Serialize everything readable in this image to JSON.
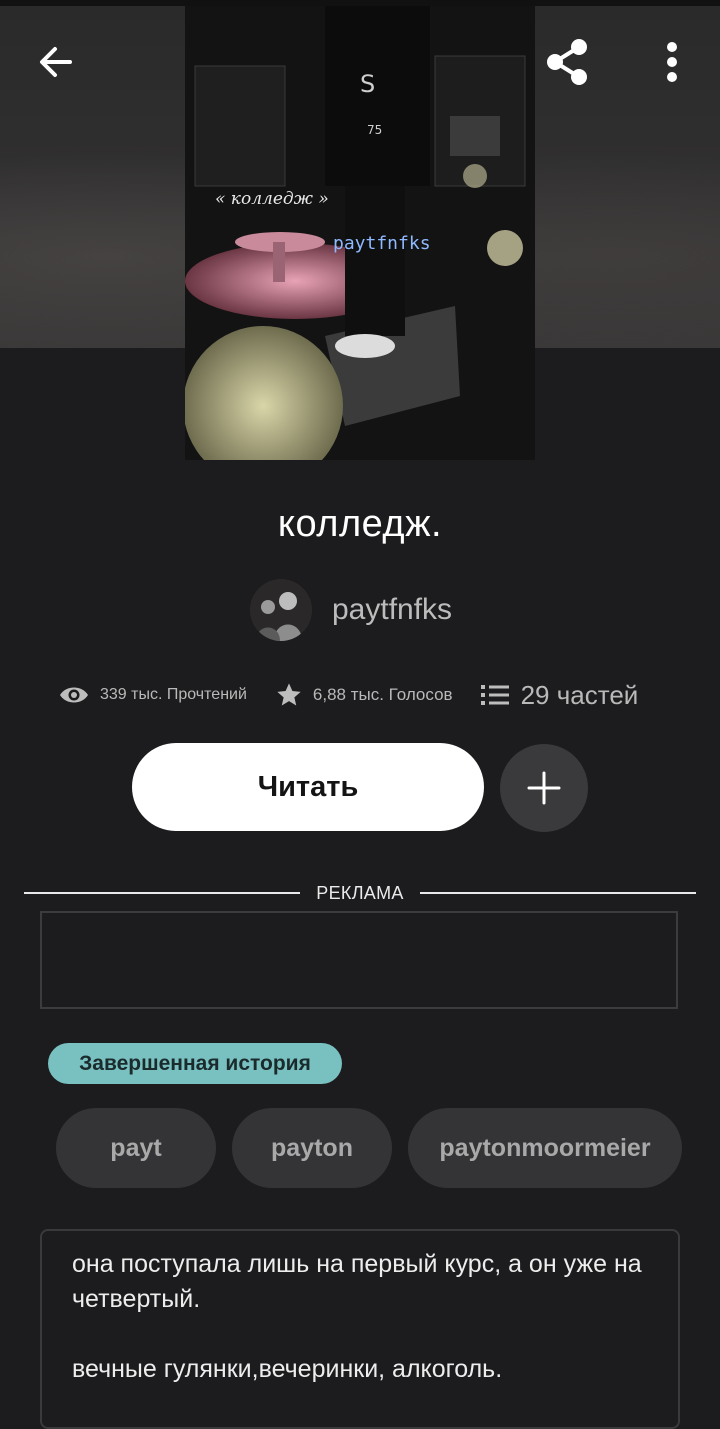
{
  "header": {
    "back_icon": "arrow-left-icon",
    "share_icon": "share-icon",
    "menu_icon": "more-vertical-icon"
  },
  "cover": {
    "title_text": "« колледж »",
    "author_text": "paytfnfks"
  },
  "story": {
    "title": "колледж.",
    "author": "paytfnfks"
  },
  "stats": {
    "reads": "339 тыс. Прочтений",
    "votes": "6,88 тыс. Голосов",
    "parts": "29 частей"
  },
  "actions": {
    "read_label": "Читать",
    "add_icon": "plus-icon"
  },
  "ad": {
    "label": "РЕКЛАМА"
  },
  "status_badge": "Завершенная история",
  "tags": [
    "payt",
    "payton",
    "paytonmoormeier"
  ],
  "description": {
    "line1": "она поступала лишь на первый курс, а он уже на четвертый.",
    "line2": "вечные гулянки,вечеринки, алкоголь."
  },
  "colors": {
    "background": "#1c1b1d",
    "badge": "#79c0c1",
    "read_button": "#ffffff"
  }
}
